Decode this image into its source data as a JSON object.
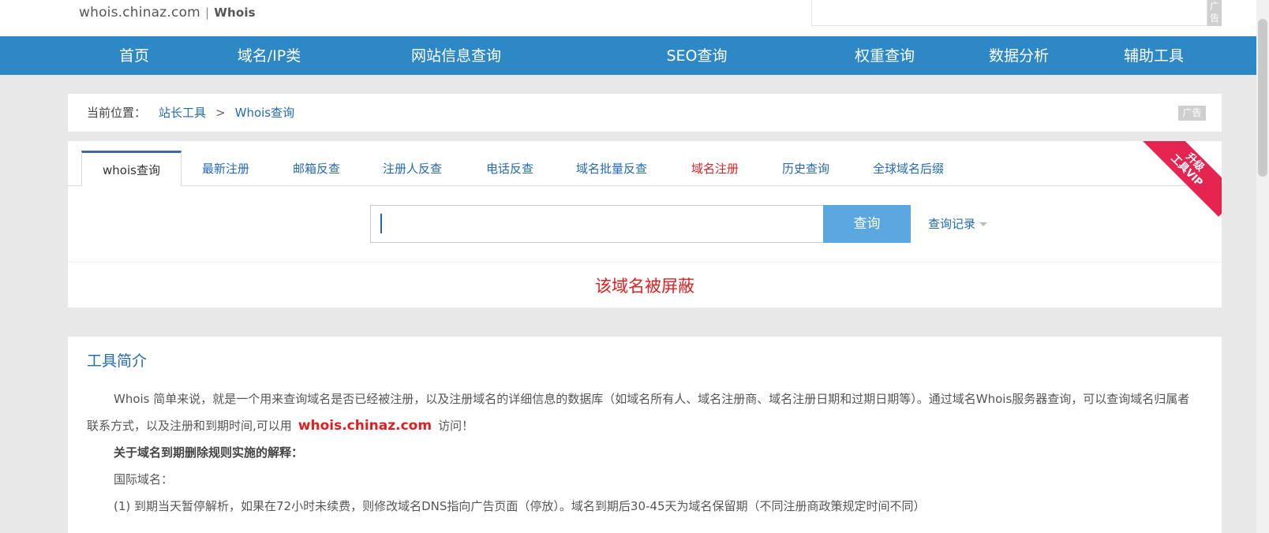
{
  "header": {
    "site_domain": "whois.chinaz.com",
    "separator": "|",
    "product": "Whois",
    "top_ad_label": "广告"
  },
  "nav": {
    "items": [
      "首页",
      "域名/IP类",
      "网站信息查询",
      "SEO查询",
      "权重查询",
      "数据分析",
      "辅助工具"
    ]
  },
  "breadcrumb": {
    "label": "当前位置：",
    "items": [
      "站长工具",
      "Whois查询"
    ],
    "separator": ">",
    "ad_label": "广告"
  },
  "search": {
    "tabs": [
      "whois查询",
      "最新注册",
      "邮箱反查",
      "注册人反查",
      "电话反查",
      "域名批量反查",
      "域名注册",
      "历史查询",
      "全球域名后缀"
    ],
    "active_tab_index": 0,
    "highlight_tab_index": 6,
    "vip_ribbon": [
      "升级",
      "工具VIP"
    ],
    "input_value": "",
    "button_label": "查询",
    "history_label": "查询记录",
    "result_message": "该域名被屏蔽"
  },
  "intro": {
    "title": "工具简介",
    "para1_text": "Whois 简单来说，就是一个用来查询域名是否已经被注册，以及注册域名的详细信息的数据库（如域名所有人、域名注册商、域名注册日期和过期日期等）。通过域名Whois服务器查询，可以查询域名归属者联系方式，以及注册和到期时间,可以用",
    "para1_link": "whois.chinaz.com",
    "para1_tail": "访问！",
    "rule_heading": "关于域名到期删除规则实施的解释：",
    "intl_label": "国际域名：",
    "rule_1": "(1) 到期当天暂停解析，如果在72小时未续费，则修改域名DNS指向广告页面（停放）。域名到期后30-45天为域名保留期（不同注册商政策规定时间不同）"
  },
  "colors": {
    "nav_bg": "#2e88c6",
    "link": "#2469b3",
    "alert_red": "#e02020",
    "button_bg": "#5aa8df",
    "page_bg": "#e8e8e8"
  }
}
